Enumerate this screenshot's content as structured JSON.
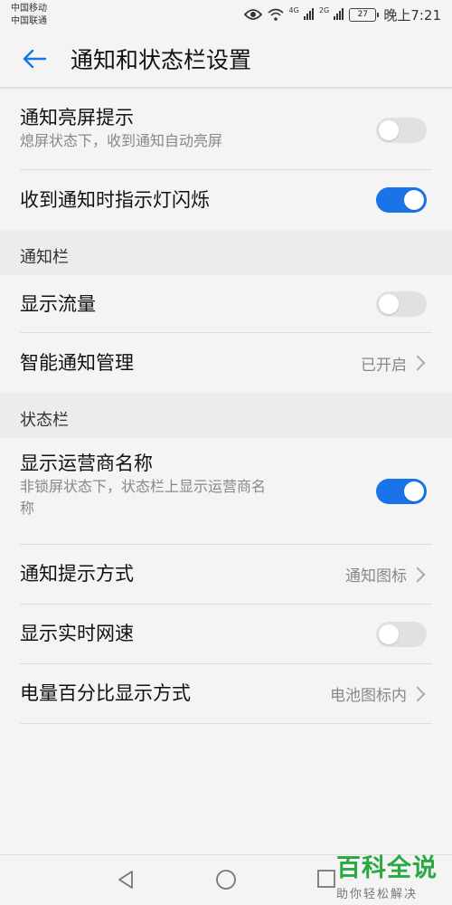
{
  "status_bar": {
    "carrier_1": "中国移动",
    "carrier_2": "中国联通",
    "signal_1_tag": "4G",
    "signal_2_tag": "2G",
    "battery_level": "27",
    "time": "晚上7:21"
  },
  "header": {
    "title": "通知和状态栏设置",
    "back_icon": "back-arrow-icon",
    "accent_color": "#1a73e8"
  },
  "items": {
    "wake_screen": {
      "label": "通知亮屏提示",
      "desc": "熄屏状态下，收到通知自动亮屏",
      "enabled": false
    },
    "led_blink": {
      "label": "收到通知时指示灯闪烁",
      "enabled": true
    },
    "show_traffic": {
      "label": "显示流量",
      "enabled": false
    },
    "smart_manage": {
      "label": "智能通知管理",
      "value": "已开启"
    },
    "show_carrier": {
      "label": "显示运营商名称",
      "desc_line1": "非锁屏状态下，状态栏上显示运营商名",
      "desc_line2": "称",
      "enabled": true
    },
    "notify_style": {
      "label": "通知提示方式",
      "value": "通知图标"
    },
    "net_speed": {
      "label": "显示实时网速",
      "enabled": false
    },
    "battery_percent": {
      "label": "电量百分比显示方式",
      "value": "电池图标内"
    }
  },
  "sections": {
    "notification_bar": "通知栏",
    "status_bar": "状态栏"
  },
  "watermark": {
    "title": "百科全说",
    "subtitle": "助你轻松解决"
  }
}
